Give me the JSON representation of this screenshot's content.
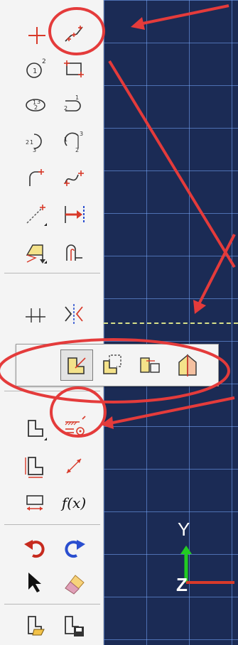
{
  "toolbox": {
    "tools": [
      {
        "icon": "create-isolated-point-icon"
      },
      {
        "icon": "create-lines-connected-icon"
      },
      {
        "icon": "circle-center-perimeter-icon"
      },
      {
        "icon": "rectangle-icon"
      },
      {
        "icon": "ellipse-icon"
      },
      {
        "icon": "fillet-icon"
      },
      {
        "icon": "arc-center-icon"
      },
      {
        "icon": "arc-tangent-icon"
      },
      {
        "icon": "fillet-between-curves-icon"
      },
      {
        "icon": "spline-icon"
      },
      {
        "icon": "construction-line-icon"
      },
      {
        "icon": "auto-trim-icon"
      },
      {
        "icon": "project-edges-icon"
      },
      {
        "icon": "offset-curve-icon"
      },
      {
        "icon": "split-icon"
      },
      {
        "icon": "mirror-icon"
      },
      {
        "icon": "translate-icon"
      },
      {
        "icon": "add-constraint-icon"
      },
      {
        "icon": "dimension-icon"
      },
      {
        "icon": "parameter-manager-icon"
      },
      {
        "icon": "undo-icon"
      },
      {
        "icon": "redo-icon"
      },
      {
        "icon": "select-arrow-icon"
      },
      {
        "icon": "eraser-icon"
      },
      {
        "icon": "open-sketch-icon"
      },
      {
        "icon": "save-sketch-icon"
      }
    ],
    "fx_text": "f(x)"
  },
  "flyout": {
    "items": [
      "translate-icon",
      "rotate-icon",
      "scale-icon",
      "mirror-icon"
    ]
  },
  "axes": {
    "y_label": "Y",
    "z_label": "Z"
  },
  "colors": {
    "viewport": "#1b2b55",
    "grid": "#78aaff",
    "annotation": "#e43b3b",
    "icon_red": "#d83a2a",
    "axis_green": "#22cc22"
  }
}
